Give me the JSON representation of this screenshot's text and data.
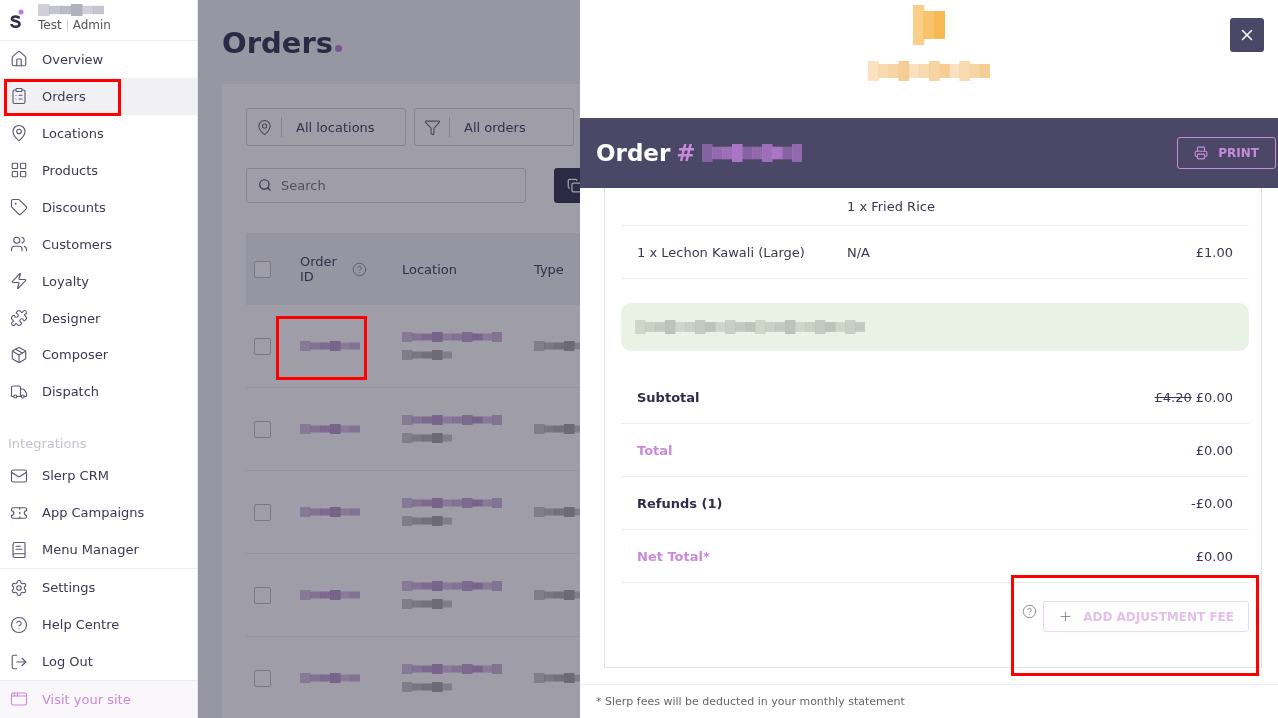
{
  "sidebar": {
    "role": "Test",
    "account": "Admin",
    "nav_items": [
      {
        "label": "Overview",
        "selected": false
      },
      {
        "label": "Orders",
        "selected": true
      },
      {
        "label": "Locations",
        "selected": false
      },
      {
        "label": "Products",
        "selected": false
      },
      {
        "label": "Discounts",
        "selected": false
      },
      {
        "label": "Customers",
        "selected": false
      },
      {
        "label": "Loyalty",
        "selected": false
      },
      {
        "label": "Designer",
        "selected": false
      },
      {
        "label": "Composer",
        "selected": false
      },
      {
        "label": "Dispatch",
        "selected": false
      }
    ],
    "integrations": {
      "heading": "Integrations",
      "items": [
        {
          "label": "Slerp CRM",
          "selected": false
        },
        {
          "label": "App Campaigns",
          "selected": false
        },
        {
          "label": "Menu Manager",
          "selected": false
        }
      ]
    },
    "footer_items": [
      {
        "label": "Settings",
        "selected": false
      },
      {
        "label": "Help Centre",
        "selected": false
      },
      {
        "label": "Log Out",
        "selected": false
      }
    ],
    "visit_site": "Visit your site"
  },
  "orders_page": {
    "title": "Orders",
    "filters": [
      "All locations",
      "All orders"
    ],
    "search": {
      "placeholder": "Search"
    },
    "table": {
      "columns": [
        "Order ID",
        "Location",
        "Type"
      ],
      "select_all_checked": false,
      "rows": [
        {
          "checked": false
        },
        {
          "checked": false
        },
        {
          "checked": false
        },
        {
          "checked": false
        },
        {
          "checked": false
        }
      ]
    }
  },
  "order_drawer": {
    "title": "Order",
    "number_prefix": "#",
    "print_button": "PRINT",
    "items": [
      {
        "modifiers": "1 x Fried Rice"
      },
      {
        "name": "1 x Lechon Kawali (Large)",
        "modifiers": "N/A",
        "price": "£1.00"
      }
    ],
    "summary": [
      {
        "label": "Subtotal",
        "kind": "strong",
        "original": "£4.20",
        "value": "£0.00"
      },
      {
        "label": "Total",
        "kind": "accent",
        "value": "£0.00"
      },
      {
        "label": "Refunds (1)",
        "kind": "strong",
        "value": "-£0.00"
      },
      {
        "label": "Net Total*",
        "kind": "accent",
        "value": "£0.00"
      }
    ],
    "adjustment_button": {
      "label": "ADD ADJUSTMENT FEE",
      "disabled": true
    },
    "footnote": "* Slerp fees will be deducted in your monthly statement"
  }
}
